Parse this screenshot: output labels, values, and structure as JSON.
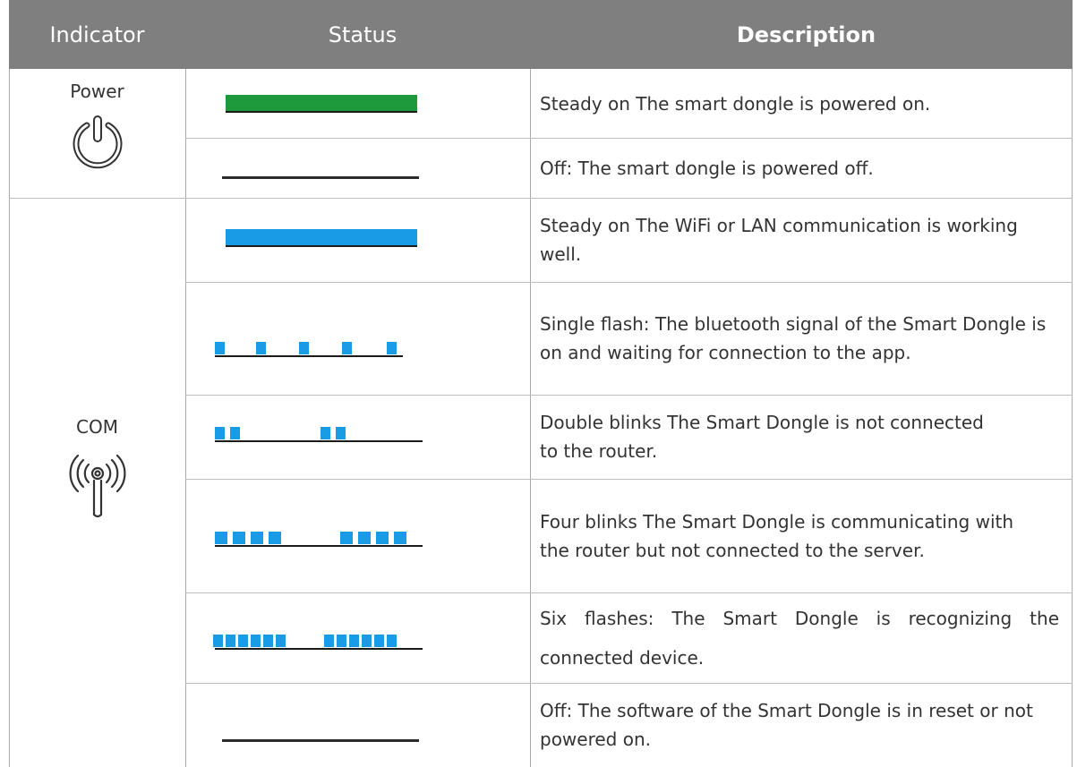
{
  "header": {
    "indicator": "Indicator",
    "status": "Status",
    "description": "Description"
  },
  "groups": [
    {
      "indicator": "Power",
      "icon": "power-icon"
    },
    {
      "indicator": "COM",
      "icon": "wireless-signal-icon"
    }
  ],
  "rows": [
    {
      "pattern": "steady",
      "color": "#1e9a3c",
      "description": "Steady on The smart dongle is powered on."
    },
    {
      "pattern": "off",
      "color": "#2b2b2b",
      "description": "Off: The smart dongle is powered off."
    },
    {
      "pattern": "steady",
      "color": "#1a9be6",
      "description": "Steady on The WiFi or LAN communication is working well."
    },
    {
      "pattern": "single-flash",
      "color": "#1a9be6",
      "description": "Single flash: The bluetooth signal of the Smart Dongle is on and waiting for connection to the app."
    },
    {
      "pattern": "double-blink",
      "color": "#1a9be6",
      "description": "Double blinks The Smart Dongle is not connected to the router."
    },
    {
      "pattern": "four-blinks",
      "color": "#1a9be6",
      "description": "Four blinks The Smart Dongle is communicating with the router but not connected to the server."
    },
    {
      "pattern": "six-flashes",
      "color": "#1a9be6",
      "description": "Six flashes: The Smart Dongle is recognizing the connected device."
    },
    {
      "pattern": "off",
      "color": "#2b2b2b",
      "description": "Off: The software of the Smart Dongle is in reset or not powered on."
    }
  ]
}
